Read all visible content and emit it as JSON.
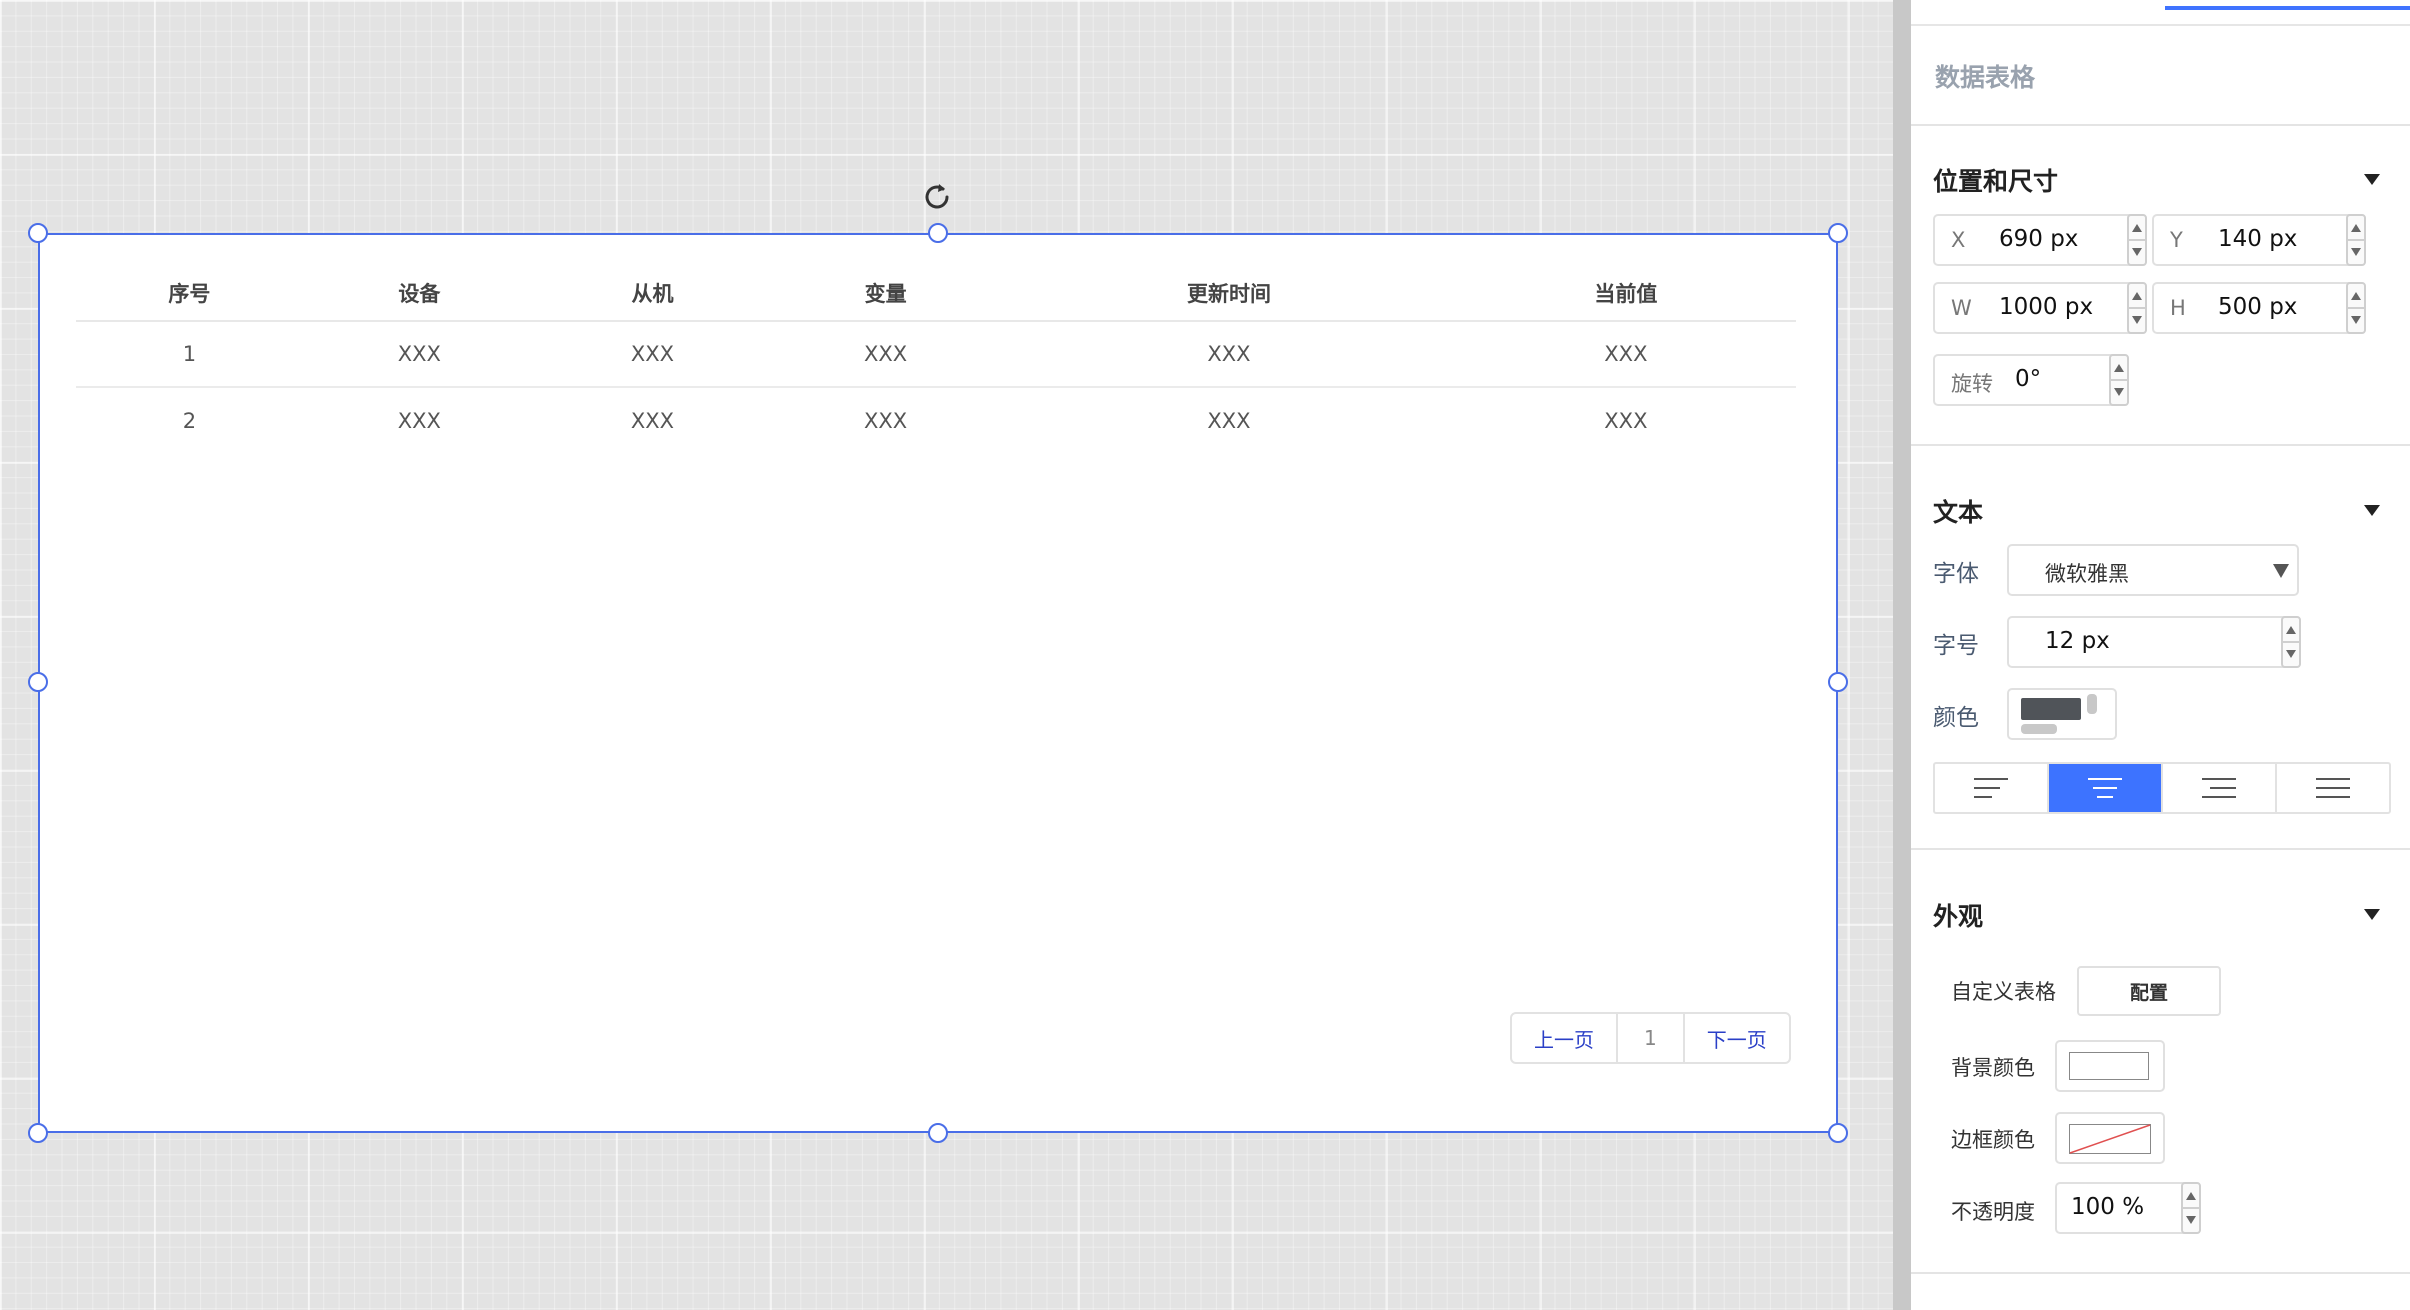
{
  "table": {
    "headers": [
      "序号",
      "设备",
      "从机",
      "变量",
      "更新时间",
      "当前值"
    ],
    "rows": [
      [
        "1",
        "XXX",
        "XXX",
        "XXX",
        "XXX",
        "XXX"
      ],
      [
        "2",
        "XXX",
        "XXX",
        "XXX",
        "XXX",
        "XXX"
      ]
    ]
  },
  "pager": {
    "prev": "上一页",
    "current": "1",
    "next": "下一页"
  },
  "panel": {
    "title": "数据表格",
    "position": {
      "title": "位置和尺寸",
      "x_label": "X",
      "x_value": "690 px",
      "y_label": "Y",
      "y_value": "140 px",
      "w_label": "W",
      "w_value": "1000 px",
      "h_label": "H",
      "h_value": "500 px",
      "rotate_label": "旋转",
      "rotate_value": "0°"
    },
    "text": {
      "title": "文本",
      "font_label": "字体",
      "font_value": "微软雅黑",
      "size_label": "字号",
      "size_value": "12 px",
      "color_label": "颜色",
      "color_value": "#505459"
    },
    "appearance": {
      "title": "外观",
      "custom_label": "自定义表格",
      "config_button": "配置",
      "bg_label": "背景颜色",
      "bg_value": "#ffffff",
      "border_label": "边框颜色",
      "opacity_label": "不透明度",
      "opacity_value": "100 %"
    }
  },
  "colors": {
    "accent": "#3d73ff",
    "selection": "#4a6ee8",
    "link": "#2a3fc7"
  }
}
